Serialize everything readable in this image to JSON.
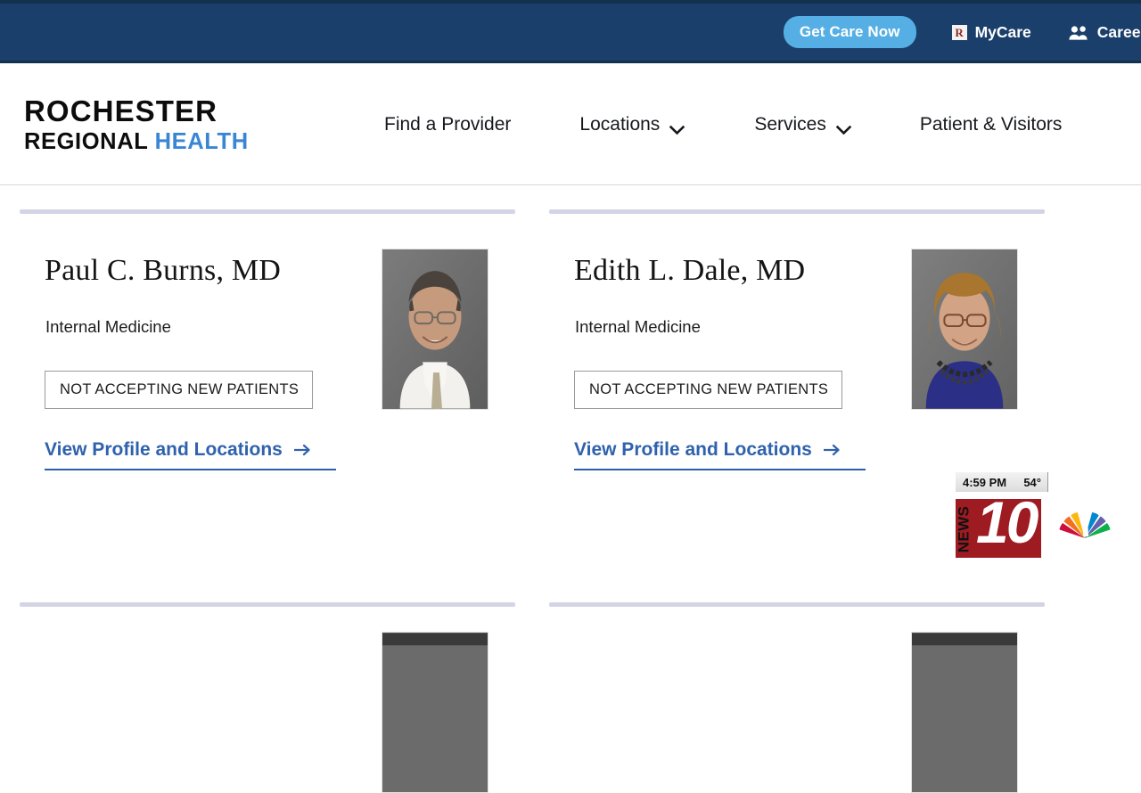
{
  "utility_bar": {
    "background_color": "#1b3f6b",
    "get_care_now": {
      "label": "Get Care Now",
      "color": "#55afe4"
    },
    "mycare": {
      "label": "MyCare",
      "icon": "R"
    },
    "careers": {
      "label": "Careers"
    }
  },
  "header": {
    "logo": {
      "line1": "ROCHESTER",
      "line2_dark": "REGIONAL ",
      "line2_accent": "HEALTH",
      "accent_color": "#3a86d4"
    },
    "nav": [
      {
        "label": "Find a Provider",
        "has_dropdown": false
      },
      {
        "label": "Locations",
        "has_dropdown": true
      },
      {
        "label": "Services",
        "has_dropdown": true
      },
      {
        "label": "Patient & Visitors",
        "has_dropdown": false
      }
    ]
  },
  "results": {
    "link_color": "#2f62ad",
    "cards": [
      {
        "name": "Paul C. Burns, MD",
        "specialty": "Internal Medicine",
        "status": "NOT ACCEPTING NEW PATIENTS",
        "link_label": "View Profile and Locations",
        "photo": "headshot-male"
      },
      {
        "name": "Edith L. Dale, MD",
        "specialty": "Internal Medicine",
        "status": "NOT ACCEPTING NEW PATIENTS",
        "link_label": "View Profile and Locations",
        "photo": "headshot-female"
      }
    ]
  },
  "broadcast_bug": {
    "time": "4:59 PM",
    "temperature": "54°",
    "station_word": "NEWS",
    "station_number": "10",
    "station_color": "#9e1b22",
    "network_icon": "nbc-peacock-icon"
  }
}
